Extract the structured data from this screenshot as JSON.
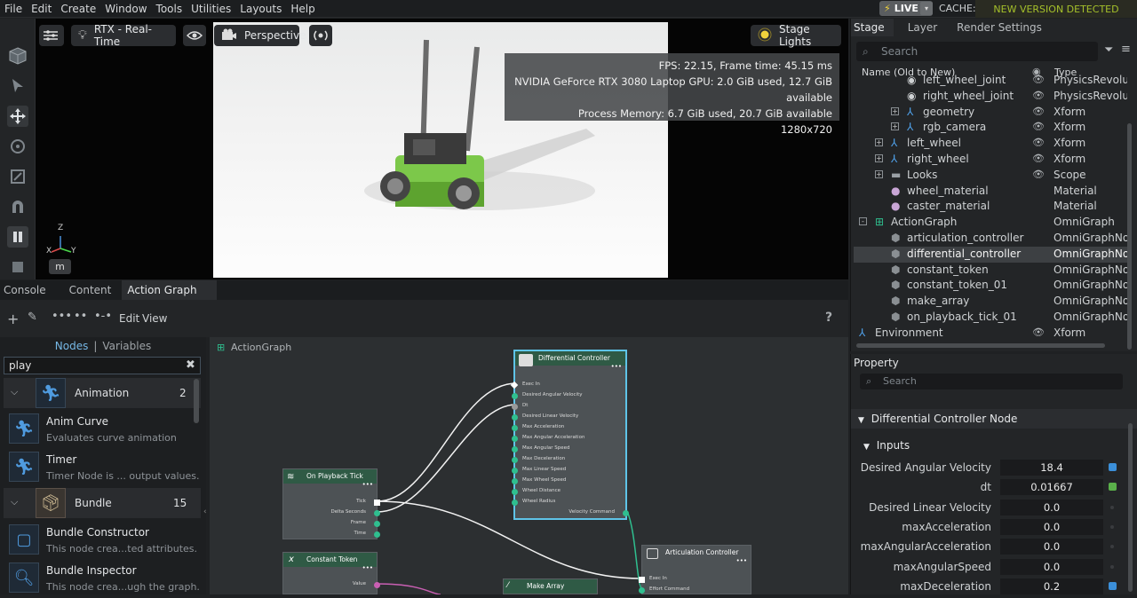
{
  "menubar": {
    "items": [
      "File",
      "Edit",
      "Create",
      "Window",
      "Tools",
      "Utilities",
      "Layouts",
      "Help"
    ],
    "live_label": "LIVE",
    "cache_label": "CACHE:",
    "cache_status": "NEW VERSION DETECTED"
  },
  "viewport": {
    "renderer": "RTX - Real-Time",
    "camera": "Perspective",
    "lights": "Stage Lights",
    "stats": {
      "fps": "FPS: 22.15, Frame time: 45.15 ms",
      "gpu": "NVIDIA GeForce RTX 3080 Laptop GPU: 2.0 GiB used, 12.7 GiB available",
      "memory": "Process Memory: 6.7 GiB used, 20.7 GiB available",
      "resolution": "1280x720"
    },
    "unit_badge": "m",
    "axis_labels": {
      "z": "Z",
      "x": "X",
      "y": "Y"
    }
  },
  "bottom_tabs": [
    "Console",
    "Content",
    "Action Graph"
  ],
  "action_graph": {
    "toolbar": {
      "edit": "Edit",
      "view": "View",
      "help": "?"
    },
    "graph_title": "ActionGraph"
  },
  "library": {
    "tab_nodes": "Nodes",
    "tab_sep": "|",
    "tab_variables": "Variables",
    "search_value": "play",
    "categories": [
      {
        "name": "Animation",
        "count": "2"
      },
      {
        "name": "Bundle",
        "count": "15"
      }
    ],
    "items": [
      {
        "title": "Anim Curve",
        "desc": "Evaluates curve animation"
      },
      {
        "title": "Timer",
        "desc": "Timer Node is ... output values."
      },
      {
        "title": "Bundle Constructor",
        "desc": "This node crea...ted attributes."
      },
      {
        "title": "Bundle Inspector",
        "desc": "This node crea...ugh the graph."
      }
    ]
  },
  "nodes": {
    "diff": {
      "title": "Differential Controller",
      "ports": [
        "Exec In",
        "Desired Angular Velocity",
        "Dt",
        "Desired Linear Velocity",
        "Max Acceleration",
        "Max Angular Acceleration",
        "Max Angular Speed",
        "Max Deceleration",
        "Max Linear Speed",
        "Max Wheel Speed",
        "Wheel Distance",
        "Wheel Radius"
      ],
      "output": "Velocity Command"
    },
    "tick": {
      "title": "On Playback Tick",
      "ports": [
        "Tick",
        "Delta Seconds",
        "Frame",
        "Time"
      ]
    },
    "token": {
      "title": "Constant Token",
      "ports": [
        "Value"
      ]
    },
    "array": {
      "title": "Make Array"
    },
    "artic": {
      "title": "Articulation Controller",
      "ports": [
        "Exec In",
        "Effort Command"
      ]
    }
  },
  "stage": {
    "tabs": [
      "Stage",
      "Layer",
      "Render Settings"
    ],
    "search_placeholder": "Search",
    "col_name": "Name (Old to New)",
    "col_type": "Type",
    "rows": [
      {
        "name": "left_wheel_joint",
        "type": "PhysicsRevolute",
        "indent": 60,
        "icon": "joint",
        "expander": "",
        "eye": true,
        "sel": false
      },
      {
        "name": "right_wheel_joint",
        "type": "PhysicsRevolute",
        "indent": 60,
        "icon": "joint",
        "expander": "",
        "eye": true,
        "sel": false
      },
      {
        "name": "geometry",
        "type": "Xform",
        "indent": 60,
        "icon": "xform",
        "expander": "+",
        "eye": true,
        "sel": false
      },
      {
        "name": "rgb_camera",
        "type": "Xform",
        "indent": 60,
        "icon": "xform",
        "expander": "+",
        "eye": true,
        "sel": false
      },
      {
        "name": "left_wheel",
        "type": "Xform",
        "indent": 42,
        "icon": "xform",
        "expander": "+",
        "eye": true,
        "sel": false
      },
      {
        "name": "right_wheel",
        "type": "Xform",
        "indent": 42,
        "icon": "xform",
        "expander": "+",
        "eye": true,
        "sel": false
      },
      {
        "name": "Looks",
        "type": "Scope",
        "indent": 42,
        "icon": "folder",
        "expander": "+",
        "eye": true,
        "sel": false
      },
      {
        "name": "wheel_material",
        "type": "Material",
        "indent": 42,
        "icon": "material",
        "expander": "",
        "eye": false,
        "sel": false
      },
      {
        "name": "caster_material",
        "type": "Material",
        "indent": 42,
        "icon": "material",
        "expander": "",
        "eye": false,
        "sel": false
      },
      {
        "name": "ActionGraph",
        "type": "OmniGraph",
        "indent": 24,
        "icon": "graph",
        "expander": "-",
        "eye": false,
        "sel": false
      },
      {
        "name": "articulation_controller",
        "type": "OmniGraphNod",
        "indent": 42,
        "icon": "node",
        "expander": "",
        "eye": false,
        "sel": false
      },
      {
        "name": "differential_controller",
        "type": "OmniGraphNod",
        "indent": 42,
        "icon": "node",
        "expander": "",
        "eye": false,
        "sel": true
      },
      {
        "name": "constant_token",
        "type": "OmniGraphNod",
        "indent": 42,
        "icon": "node",
        "expander": "",
        "eye": false,
        "sel": false
      },
      {
        "name": "constant_token_01",
        "type": "OmniGraphNod",
        "indent": 42,
        "icon": "node",
        "expander": "",
        "eye": false,
        "sel": false
      },
      {
        "name": "make_array",
        "type": "OmniGraphNod",
        "indent": 42,
        "icon": "node",
        "expander": "",
        "eye": false,
        "sel": false
      },
      {
        "name": "on_playback_tick_01",
        "type": "OmniGraphNod",
        "indent": 42,
        "icon": "node",
        "expander": "",
        "eye": false,
        "sel": false
      },
      {
        "name": "Environment",
        "type": "Xform",
        "indent": 6,
        "icon": "xform",
        "expander": "+",
        "eye": true,
        "sel": false
      }
    ]
  },
  "property": {
    "title": "Property",
    "search_placeholder": "Search",
    "node_group": "Differential Controller Node",
    "inputs_group": "Inputs",
    "fields": [
      {
        "label": "Desired Angular Velocity",
        "value": "18.4",
        "mark": "#3b8fd9"
      },
      {
        "label": "dt",
        "value": "0.01667",
        "mark": "#5ab04a"
      },
      {
        "label": "Desired Linear Velocity",
        "value": "0.0",
        "mark": ""
      },
      {
        "label": "maxAcceleration",
        "value": "0.0",
        "mark": ""
      },
      {
        "label": "maxAngularAcceleration",
        "value": "0.0",
        "mark": ""
      },
      {
        "label": "maxAngularSpeed",
        "value": "0.0",
        "mark": ""
      },
      {
        "label": "maxDeceleration",
        "value": "0.2",
        "mark": "#3b8fd9"
      }
    ]
  }
}
